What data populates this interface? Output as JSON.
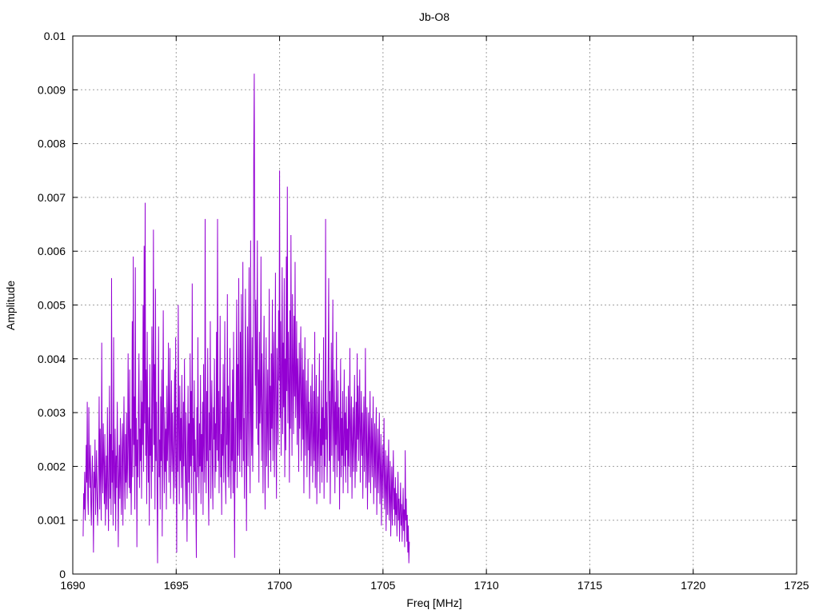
{
  "chart_data": {
    "type": "line",
    "title": "Jb-O8",
    "xlabel": "Freq [MHz]",
    "ylabel": "Amplitude",
    "xlim": [
      1690,
      1725
    ],
    "ylim": [
      0,
      0.01
    ],
    "x_ticks": [
      "1690",
      "1695",
      "1700",
      "1705",
      "1710",
      "1715",
      "1720",
      "1725"
    ],
    "y_ticks": [
      "0",
      "0.001",
      "0.002",
      "0.003",
      "0.004",
      "0.005",
      "0.006",
      "0.007",
      "0.008",
      "0.009",
      "0.01"
    ],
    "grid": true,
    "series": [
      {
        "color": "#9400d3",
        "x_start": 1690.5,
        "x_step": 0.025,
        "values": [
          0.0007,
          0.0015,
          0.0012,
          0.0019,
          0.001,
          0.0016,
          0.0024,
          0.0017,
          0.0032,
          0.0014,
          0.0011,
          0.0031,
          0.002,
          0.0016,
          0.0024,
          0.0013,
          0.0009,
          0.0018,
          0.0022,
          0.0015,
          0.0004,
          0.0019,
          0.0016,
          0.0025,
          0.0011,
          0.0017,
          0.0023,
          0.0014,
          0.0009,
          0.0015,
          0.002,
          0.0033,
          0.0012,
          0.0027,
          0.0018,
          0.001,
          0.0043,
          0.0019,
          0.0015,
          0.0028,
          0.0021,
          0.0013,
          0.0026,
          0.0009,
          0.0016,
          0.0022,
          0.0012,
          0.0031,
          0.0018,
          0.0008,
          0.002,
          0.0035,
          0.0014,
          0.0026,
          0.0011,
          0.0055,
          0.0017,
          0.0023,
          0.0009,
          0.0044,
          0.0019,
          0.0013,
          0.0027,
          0.0008,
          0.0022,
          0.0016,
          0.0032,
          0.0021,
          0.0005,
          0.0018,
          0.0024,
          0.0014,
          0.0029,
          0.0017,
          0.0011,
          0.0025,
          0.0028,
          0.0009,
          0.0023,
          0.0033,
          0.0019,
          0.0012,
          0.0026,
          0.0017,
          0.003,
          0.0014,
          0.002,
          0.0041,
          0.0024,
          0.0016,
          0.0038,
          0.0015,
          0.0027,
          0.0011,
          0.0021,
          0.0047,
          0.0018,
          0.0059,
          0.0024,
          0.0033,
          0.0012,
          0.0057,
          0.002,
          0.0029,
          0.0005,
          0.0025,
          0.0018,
          0.0031,
          0.0041,
          0.0016,
          0.0027,
          0.0021,
          0.0036,
          0.0014,
          0.0032,
          0.0024,
          0.005,
          0.0019,
          0.0061,
          0.0028,
          0.0069,
          0.0022,
          0.0038,
          0.0013,
          0.0045,
          0.0026,
          0.0017,
          0.0031,
          0.0009,
          0.0039,
          0.0022,
          0.0027,
          0.0014,
          0.0046,
          0.0019,
          0.0034,
          0.0064,
          0.0024,
          0.0039,
          0.0012,
          0.0053,
          0.0021,
          0.0032,
          0.0016,
          0.0002,
          0.0028,
          0.0046,
          0.0018,
          0.0025,
          0.0012,
          0.0033,
          0.0021,
          0.0038,
          0.0007,
          0.0029,
          0.0049,
          0.0023,
          0.0015,
          0.0031,
          0.0019,
          0.0027,
          0.0012,
          0.0035,
          0.0021,
          0.0026,
          0.0043,
          0.0017,
          0.0029,
          0.0042,
          0.0014,
          0.0024,
          0.0036,
          0.0019,
          0.003,
          0.0022,
          0.0013,
          0.0027,
          0.0038,
          0.0016,
          0.0044,
          0.0023,
          0.0004,
          0.0031,
          0.0019,
          0.005,
          0.0027,
          0.0013,
          0.0035,
          0.0021,
          0.0029,
          0.0016,
          0.0037,
          0.0023,
          0.001,
          0.0032,
          0.002,
          0.004,
          0.0025,
          0.0013,
          0.003,
          0.0018,
          0.0006,
          0.0024,
          0.0035,
          0.0017,
          0.0028,
          0.0012,
          0.0041,
          0.002,
          0.0034,
          0.0015,
          0.0054,
          0.0022,
          0.0029,
          0.0011,
          0.0036,
          0.0019,
          0.0025,
          0.0013,
          0.0003,
          0.0031,
          0.0018,
          0.0044,
          0.0022,
          0.0015,
          0.0028,
          0.002,
          0.0037,
          0.0013,
          0.0026,
          0.0019,
          0.0032,
          0.0011,
          0.0039,
          0.0024,
          0.0017,
          0.0066,
          0.0028,
          0.0015,
          0.0034,
          0.0021,
          0.0042,
          0.0018,
          0.0009,
          0.003,
          0.0023,
          0.0047,
          0.0014,
          0.0027,
          0.0036,
          0.002,
          0.0012,
          0.0031,
          0.0025,
          0.004,
          0.0016,
          0.0028,
          0.0019,
          0.0045,
          0.0023,
          0.0066,
          0.0021,
          0.0034,
          0.0015,
          0.0029,
          0.0048,
          0.0018,
          0.0026,
          0.0011,
          0.0033,
          0.0022,
          0.0039,
          0.0017,
          0.0027,
          0.0047,
          0.002,
          0.0013,
          0.0031,
          0.0024,
          0.0052,
          0.0018,
          0.0035,
          0.0016,
          0.0028,
          0.0042,
          0.002,
          0.0014,
          0.0032,
          0.0021,
          0.0038,
          0.0015,
          0.0045,
          0.0023,
          0.0003,
          0.0029,
          0.0019,
          0.0034,
          0.0051,
          0.0016,
          0.0039,
          0.0022,
          0.0055,
          0.0027,
          0.0019,
          0.0045,
          0.0025,
          0.0052,
          0.0018,
          0.0033,
          0.0058,
          0.0021,
          0.0029,
          0.0014,
          0.0036,
          0.0053,
          0.0024,
          0.0008,
          0.0031,
          0.0046,
          0.002,
          0.0038,
          0.0057,
          0.0026,
          0.0015,
          0.0062,
          0.003,
          0.0022,
          0.0044,
          0.0019,
          0.0035,
          0.0077,
          0.0093,
          0.0056,
          0.0035,
          0.0051,
          0.0027,
          0.0041,
          0.0062,
          0.0024,
          0.0038,
          0.0017,
          0.0045,
          0.0028,
          0.0033,
          0.0059,
          0.0021,
          0.0041,
          0.003,
          0.0015,
          0.0037,
          0.0048,
          0.0025,
          0.0012,
          0.0034,
          0.0044,
          0.002,
          0.0029,
          0.0038,
          0.0016,
          0.0031,
          0.0053,
          0.0023,
          0.0035,
          0.0019,
          0.0041,
          0.0027,
          0.0051,
          0.0021,
          0.0037,
          0.0045,
          0.0018,
          0.0033,
          0.0056,
          0.0026,
          0.0014,
          0.0042,
          0.0032,
          0.0024,
          0.0049,
          0.0036,
          0.0075,
          0.0029,
          0.0047,
          0.0022,
          0.0038,
          0.0057,
          0.0026,
          0.0043,
          0.0031,
          0.0055,
          0.0018,
          0.004,
          0.0023,
          0.0059,
          0.0034,
          0.0072,
          0.0028,
          0.0045,
          0.0036,
          0.0017,
          0.0049,
          0.0027,
          0.0063,
          0.0035,
          0.0022,
          0.0052,
          0.0039,
          0.0026,
          0.0048,
          0.0033,
          0.0058,
          0.0029,
          0.0036,
          0.0047,
          0.0024,
          0.004,
          0.0034,
          0.0019,
          0.0043,
          0.0027,
          0.0037,
          0.0046,
          0.0021,
          0.0031,
          0.0042,
          0.0025,
          0.0038,
          0.0015,
          0.0033,
          0.0044,
          0.0022,
          0.0029,
          0.0036,
          0.0018,
          0.0027,
          0.004,
          0.0023,
          0.0032,
          0.0014,
          0.0026,
          0.0035,
          0.002,
          0.003,
          0.0039,
          0.0017,
          0.0025,
          0.0034,
          0.0021,
          0.0045,
          0.0016,
          0.0028,
          0.0037,
          0.0013,
          0.0024,
          0.0033,
          0.0019,
          0.0029,
          0.0041,
          0.0015,
          0.0027,
          0.0022,
          0.0036,
          0.0017,
          0.0031,
          0.0024,
          0.0044,
          0.0014,
          0.0029,
          0.002,
          0.0066,
          0.0025,
          0.0032,
          0.0017,
          0.0027,
          0.0039,
          0.0055,
          0.0021,
          0.0034,
          0.0013,
          0.0029,
          0.0043,
          0.0022,
          0.0035,
          0.0051,
          0.0019,
          0.0028,
          0.0038,
          0.0015,
          0.0032,
          0.0024,
          0.0045,
          0.0018,
          0.0027,
          0.0036,
          0.0021,
          0.0031,
          0.0012,
          0.0026,
          0.004,
          0.0018,
          0.0029,
          0.0022,
          0.0034,
          0.0015,
          0.0025,
          0.0038,
          0.002,
          0.003,
          0.0017,
          0.0033,
          0.0023,
          0.0027,
          0.0015,
          0.0035,
          0.002,
          0.0028,
          0.0042,
          0.0018,
          0.0026,
          0.0033,
          0.0014,
          0.0024,
          0.0031,
          0.0019,
          0.0028,
          0.0037,
          0.0016,
          0.0023,
          0.0032,
          0.0019,
          0.0041,
          0.0025,
          0.0035,
          0.0021,
          0.0029,
          0.0038,
          0.0017,
          0.0026,
          0.0034,
          0.0022,
          0.003,
          0.0014,
          0.0025,
          0.0033,
          0.0019,
          0.0027,
          0.0042,
          0.0016,
          0.0024,
          0.0031,
          0.0012,
          0.0022,
          0.003,
          0.0017,
          0.0026,
          0.0034,
          0.0015,
          0.0023,
          0.0029,
          0.0018,
          0.0025,
          0.0033,
          0.0013,
          0.0021,
          0.0028,
          0.0016,
          0.0024,
          0.0031,
          0.0011,
          0.002,
          0.0027,
          0.0015,
          0.0022,
          0.003,
          0.0013,
          0.0019,
          0.0026,
          0.0009,
          0.0018,
          0.0024,
          0.0014,
          0.0021,
          0.0029,
          0.0012,
          0.0017,
          0.0023,
          0.0008,
          0.0016,
          0.0022,
          0.0011,
          0.0019,
          0.0025,
          0.001,
          0.0015,
          0.0021,
          0.0007,
          0.0014,
          0.002,
          0.0009,
          0.0017,
          0.0023,
          0.0012,
          0.0016,
          0.0009,
          0.0018,
          0.0011,
          0.0015,
          0.0007,
          0.0013,
          0.0019,
          0.001,
          0.0014,
          0.0006,
          0.0012,
          0.0017,
          0.0009,
          0.0013,
          0.0006,
          0.0011,
          0.0016,
          0.0008,
          0.0012,
          0.0005,
          0.0023,
          0.001,
          0.0014,
          0.0006,
          0.0011,
          0.0004,
          0.0009,
          0.0002,
          0.0006
        ]
      }
    ]
  }
}
